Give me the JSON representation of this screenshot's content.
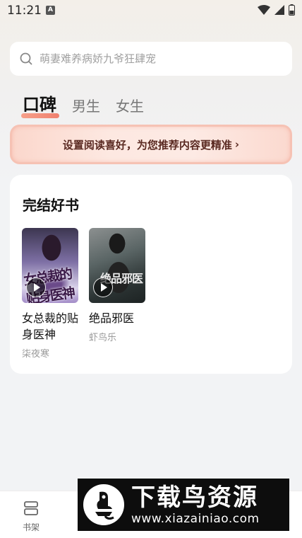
{
  "status_bar": {
    "time": "11:21",
    "notification_icon": "A"
  },
  "search": {
    "placeholder": "萌妻难养病娇九爷狂肆宠"
  },
  "tabs": [
    {
      "label": "口碑",
      "active": true
    },
    {
      "label": "男生",
      "active": false
    },
    {
      "label": "女生",
      "active": false
    }
  ],
  "preference_banner": {
    "label": "设置阅读喜好，为您推荐内容更精准",
    "chevron": "›"
  },
  "section": {
    "title": "完结好书",
    "books": [
      {
        "title": "女总裁的贴身医神",
        "author": "柒夜寒",
        "cover_text": "女总裁的贴身医神"
      },
      {
        "title": "绝品邪医",
        "author": "虾鸟乐",
        "cover_text": "绝品邪医"
      }
    ]
  },
  "bottom_nav": {
    "bookshelf_label": "书架"
  },
  "watermark": {
    "title": "下载鸟资源",
    "url": "www.xiazainiao.com"
  },
  "colors": {
    "accent": "#f0806e",
    "banner_text": "#5a2a22"
  }
}
